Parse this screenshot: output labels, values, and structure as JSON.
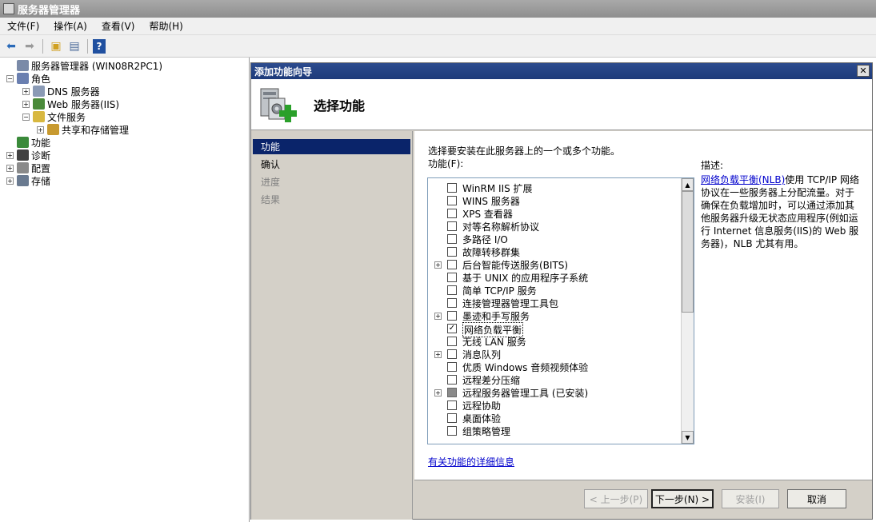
{
  "window": {
    "title": "服务器管理器"
  },
  "menu": [
    "文件(F)",
    "操作(A)",
    "查看(V)",
    "帮助(H)"
  ],
  "toolbar_icons": [
    "back-arrow-icon",
    "forward-arrow-icon",
    "up-folder-icon",
    "show-hide-tree-icon",
    "help-icon"
  ],
  "tree": [
    {
      "label": "服务器管理器 (WIN08R2PC1)",
      "level": 0,
      "expander": "",
      "icon": "server-manager-icon",
      "color": "#7a8aa8"
    },
    {
      "label": "角色",
      "level": 0,
      "expander": "-",
      "icon": "roles-icon",
      "color": "#6a7fb0"
    },
    {
      "label": "DNS 服务器",
      "level": 1,
      "expander": "+",
      "icon": "dns-server-icon",
      "color": "#8a9ab5"
    },
    {
      "label": "Web 服务器(IIS)",
      "level": 1,
      "expander": "+",
      "icon": "web-server-icon",
      "color": "#4a8a3a"
    },
    {
      "label": "文件服务",
      "level": 1,
      "expander": "-",
      "icon": "file-services-icon",
      "color": "#d8b840"
    },
    {
      "label": "共享和存储管理",
      "level": 2,
      "expander": "+",
      "icon": "share-storage-icon",
      "color": "#c89a30"
    },
    {
      "label": "功能",
      "level": 0,
      "expander": "",
      "icon": "features-icon",
      "color": "#3a8a3a"
    },
    {
      "label": "诊断",
      "level": 0,
      "expander": "+",
      "icon": "diagnostics-icon",
      "color": "#404040"
    },
    {
      "label": "配置",
      "level": 0,
      "expander": "+",
      "icon": "configuration-icon",
      "color": "#8a8a8a"
    },
    {
      "label": "存储",
      "level": 0,
      "expander": "+",
      "icon": "storage-icon",
      "color": "#6a7a90"
    }
  ],
  "dialog": {
    "title": "添加功能向导",
    "header_title": "选择功能",
    "steps": [
      {
        "label": "功能",
        "state": "active"
      },
      {
        "label": "确认",
        "state": "normal"
      },
      {
        "label": "进度",
        "state": "disabled"
      },
      {
        "label": "结果",
        "state": "disabled"
      }
    ],
    "instruction": "选择要安装在此服务器上的一个或多个功能。",
    "features_label": "功能(F):",
    "features": [
      {
        "label": "WinRM IIS 扩展",
        "expander": "",
        "state": "unchecked"
      },
      {
        "label": "WINS 服务器",
        "expander": "",
        "state": "unchecked"
      },
      {
        "label": "XPS 查看器",
        "expander": "",
        "state": "unchecked"
      },
      {
        "label": "对等名称解析协议",
        "expander": "",
        "state": "unchecked"
      },
      {
        "label": "多路径 I/O",
        "expander": "",
        "state": "unchecked"
      },
      {
        "label": "故障转移群集",
        "expander": "",
        "state": "unchecked"
      },
      {
        "label": "后台智能传送服务(BITS)",
        "expander": "+",
        "state": "unchecked"
      },
      {
        "label": "基于 UNIX 的应用程序子系统",
        "expander": "",
        "state": "unchecked"
      },
      {
        "label": "简单 TCP/IP 服务",
        "expander": "",
        "state": "unchecked"
      },
      {
        "label": "连接管理器管理工具包",
        "expander": "",
        "state": "unchecked"
      },
      {
        "label": "墨迹和手写服务",
        "expander": "+",
        "state": "unchecked"
      },
      {
        "label": "网络负载平衡",
        "expander": "",
        "state": "checked"
      },
      {
        "label": "无线 LAN 服务",
        "expander": "",
        "state": "unchecked"
      },
      {
        "label": "消息队列",
        "expander": "+",
        "state": "unchecked"
      },
      {
        "label": "优质 Windows 音频视频体验",
        "expander": "",
        "state": "unchecked"
      },
      {
        "label": "远程差分压缩",
        "expander": "",
        "state": "unchecked"
      },
      {
        "label": "远程服务器管理工具  (已安装)",
        "expander": "+",
        "state": "installed"
      },
      {
        "label": "远程协助",
        "expander": "",
        "state": "unchecked"
      },
      {
        "label": "桌面体验",
        "expander": "",
        "state": "unchecked"
      },
      {
        "label": "组策略管理",
        "expander": "",
        "state": "unchecked"
      }
    ],
    "selected_feature": "网络负载平衡",
    "detail_link": "有关功能的详细信息",
    "description_title": "描述:",
    "description_link": "网络负载平衡(NLB)",
    "description_text": "使用 TCP/IP 网络协议在一些服务器上分配流量。对于确保在负载增加时，可以通过添加其他服务器升级无状态应用程序(例如运行 Internet 信息服务(IIS)的 Web 服务器)，NLB 尤其有用。",
    "buttons": {
      "prev": "< 上一步(P)",
      "next": "下一步(N) >",
      "install": "安装(I)",
      "cancel": "取消"
    },
    "close_label": "✕"
  },
  "colors": {
    "accent": "#0a246a",
    "link": "#0000cc",
    "dialog_bg": "#d4d0c8"
  }
}
